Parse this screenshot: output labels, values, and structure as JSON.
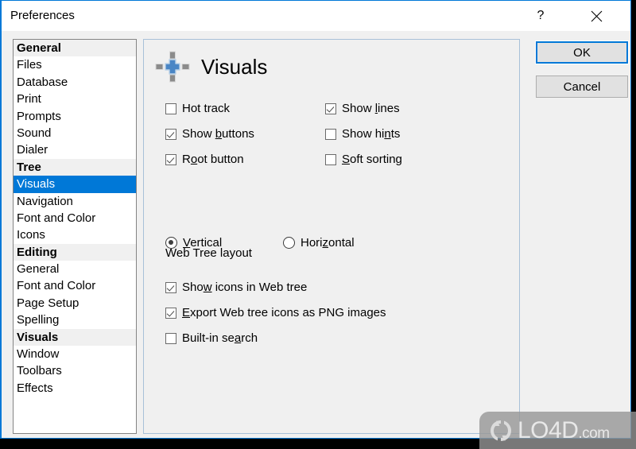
{
  "window": {
    "title": "Preferences",
    "help_glyph": "?",
    "help_name": "help-button",
    "close_name": "close-button"
  },
  "categories": [
    {
      "label": "General",
      "type": "group"
    },
    {
      "label": "Files",
      "type": "item"
    },
    {
      "label": "Database",
      "type": "item"
    },
    {
      "label": "Print",
      "type": "item"
    },
    {
      "label": "Prompts",
      "type": "item"
    },
    {
      "label": "Sound",
      "type": "item"
    },
    {
      "label": "Dialer",
      "type": "item"
    },
    {
      "label": "Tree",
      "type": "group"
    },
    {
      "label": "Visuals",
      "type": "item",
      "selected": true
    },
    {
      "label": "Navigation",
      "type": "item"
    },
    {
      "label": "Font and Color",
      "type": "item"
    },
    {
      "label": "Icons",
      "type": "item"
    },
    {
      "label": "Editing",
      "type": "group"
    },
    {
      "label": "General",
      "type": "item"
    },
    {
      "label": "Font and Color",
      "type": "item"
    },
    {
      "label": "Page Setup",
      "type": "item"
    },
    {
      "label": "Spelling",
      "type": "item"
    },
    {
      "label": "Visuals",
      "type": "group"
    },
    {
      "label": "Window",
      "type": "item"
    },
    {
      "label": "Toolbars",
      "type": "item"
    },
    {
      "label": "Effects",
      "type": "item"
    }
  ],
  "panel": {
    "title": "Visuals",
    "icon_name": "visuals-crosshair-icon",
    "accent_color": "#4a86c5",
    "options_top": [
      {
        "id": "hot_track",
        "pre": "H",
        "acc": "",
        "post": "ot track",
        "checked": false,
        "col": "left",
        "row": 0
      },
      {
        "id": "show_buttons",
        "pre": "Show ",
        "acc": "b",
        "post": "uttons",
        "checked": true,
        "col": "left",
        "row": 1
      },
      {
        "id": "root_button",
        "pre": "R",
        "acc": "o",
        "post": "ot button",
        "checked": true,
        "col": "left",
        "row": 2
      },
      {
        "id": "show_lines",
        "pre": "Show ",
        "acc": "l",
        "post": "ines",
        "checked": true,
        "col": "right",
        "row": 0
      },
      {
        "id": "show_hints",
        "pre": "Show hi",
        "acc": "n",
        "post": "ts",
        "checked": false,
        "col": "right",
        "row": 1
      },
      {
        "id": "soft_sorting",
        "pre": "",
        "acc": "S",
        "post": "oft sorting",
        "checked": false,
        "col": "right",
        "row": 2
      }
    ],
    "group_label": "Web Tree layout",
    "layout_options": [
      {
        "id": "vertical",
        "pre": "",
        "acc": "V",
        "post": "ertical",
        "selected": true,
        "col": "left"
      },
      {
        "id": "horizontal",
        "pre": "Hori",
        "acc": "z",
        "post": "ontal",
        "selected": false,
        "col": "right"
      }
    ],
    "options_bottom": [
      {
        "id": "show_icons_web_tree",
        "pre": "Sho",
        "acc": "w",
        "post": " icons in Web tree",
        "checked": true
      },
      {
        "id": "export_png",
        "pre": "",
        "acc": "E",
        "post": "xport Web tree icons as PNG images",
        "checked": true
      },
      {
        "id": "builtin_search",
        "pre": "Built-in se",
        "acc": "a",
        "post": "rch",
        "checked": false
      }
    ]
  },
  "buttons": {
    "ok": "OK",
    "cancel": "Cancel"
  },
  "watermark": {
    "brand": "LO4D",
    "suffix": ".com",
    "logo_name": "refresh-arrows-logo"
  }
}
